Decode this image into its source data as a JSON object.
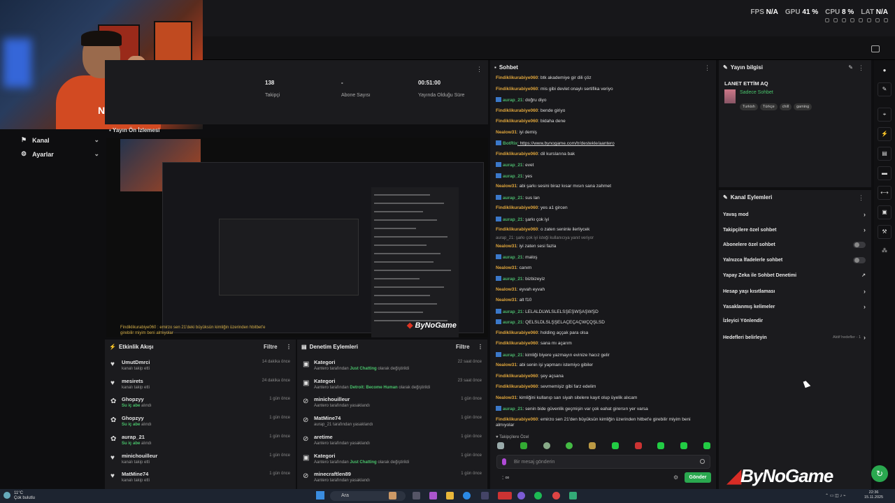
{
  "hud": {
    "fps_label": "FPS",
    "fps_value": "N/A",
    "gpu_label": "GPU",
    "gpu_value": "41 %",
    "cpu_label": "CPU",
    "cpu_value": "8 %",
    "lat_label": "LAT",
    "lat_value": "N/A"
  },
  "webcam": {
    "shirt_text": "NBA"
  },
  "sidebar": {
    "items": [
      {
        "label": "Kanal",
        "icon": "channel-icon"
      },
      {
        "label": "Ayarlar",
        "icon": "gear-icon"
      }
    ]
  },
  "stats": [
    {
      "value": "138",
      "label": "Takipçi"
    },
    {
      "value": "-",
      "label": "Abone Sayısı"
    },
    {
      "value": "00:51:00",
      "label": "Yayında Olduğu Süre"
    }
  ],
  "preview": {
    "title": "Yayın Ön İzlemesi",
    "caption": "Findiklikurabiye060 : emirzo sen 21'deki büyüksün kimliğin üzerinden hbitbet'e girebilir miyim beni almıyolar",
    "logo": "ByNoGame"
  },
  "activity": {
    "title": "Etkinlik Akışı",
    "filter": "Filtre",
    "items": [
      {
        "name": "UmutDmrci",
        "desc": "kanalı takip etti",
        "time": "14 dakika önce",
        "icon": "heart-icon"
      },
      {
        "name": "mesirets",
        "desc": "kanalı takip etti",
        "time": "24 dakika önce",
        "icon": "heart-icon"
      },
      {
        "name": "Ghopzyy",
        "desc_pre": "",
        "desc_hl": "Su iç abe",
        "desc_post": " alındı",
        "time": "1 gün önce",
        "icon": "reward-icon"
      },
      {
        "name": "Ghopzyy",
        "desc_pre": "",
        "desc_hl": "Su iç abe",
        "desc_post": " alındı",
        "time": "1 gün önce",
        "icon": "reward-icon"
      },
      {
        "name": "aurap_21",
        "desc_pre": "",
        "desc_hl": "Su iç abe",
        "desc_post": " alındı",
        "time": "1 gün önce",
        "icon": "reward-icon"
      },
      {
        "name": "minichouilleur",
        "desc": "kanalı takip etti",
        "time": "1 gün önce",
        "icon": "heart-icon"
      },
      {
        "name": "MatMine74",
        "desc": "kanalı takip etti",
        "time": "1 gün önce",
        "icon": "heart-icon"
      }
    ]
  },
  "moderation": {
    "title": "Denetim Eylemleri",
    "filter": "Filtre",
    "items": [
      {
        "name": "Kategori",
        "desc_pre": "Aantero tarafından ",
        "desc_hl": "Just Chatting",
        "desc_post": " olarak değiştirildi",
        "time": "22 saat önce",
        "icon": "category-icon"
      },
      {
        "name": "Kategori",
        "desc_pre": "Aantero tarafından ",
        "desc_hl": "Detroit: Become Human",
        "desc_post": " olarak değiştirildi",
        "time": "23 saat önce",
        "icon": "category-icon"
      },
      {
        "name": "minichouilleur",
        "desc": "Aantero tarafından yasaklandı",
        "time": "1 gün önce",
        "icon": "ban-icon"
      },
      {
        "name": "MatMine74",
        "desc": "aurap_21 tarafından yasaklandı",
        "time": "1 gün önce",
        "icon": "ban-icon"
      },
      {
        "name": "aretime",
        "desc": "Aantero tarafından yasaklandı",
        "time": "1 gün önce",
        "icon": "ban-icon"
      },
      {
        "name": "Kategori",
        "desc_pre": "Aantero tarafından ",
        "desc_hl": "Just Chatting",
        "desc_post": " olarak değiştirildi",
        "time": "1 gün önce",
        "icon": "category-icon"
      },
      {
        "name": "minecraftlen89",
        "desc": "Aantero tarafından yasaklandı",
        "time": "1 gün önce",
        "icon": "ban-icon"
      }
    ]
  },
  "chat": {
    "title": "Sohbet",
    "placeholder": "Bir mesaj gönderin",
    "send": "Gönder",
    "followers_only": "Takipçilere Özel",
    "reply_note": "aurap_21: şarkı çok iyi isteği kullanıcıya yanıt veriyor",
    "input_prefix": ":",
    "messages": [
      {
        "user": "Findiklikurabiye060",
        "text": ": btk akademiye gir dili çöz",
        "color": "#e0a63c",
        "badge": false
      },
      {
        "user": "Findiklikurabiye060",
        "text": ": mis gibi devlet onaylı sertifika veriyo",
        "color": "#e0a63c",
        "badge": false
      },
      {
        "user": "aurap_21",
        "text": ": doğru diyo",
        "color": "#4ab56b",
        "badge": true
      },
      {
        "user": "Findiklikurabiye060",
        "text": ": bende giriyo",
        "color": "#e0a63c",
        "badge": false
      },
      {
        "user": "Findiklikurabiye060",
        "text": ": bidaha dene",
        "color": "#e0a63c",
        "badge": false
      },
      {
        "user": "Nealow31",
        "text": ": iyi demiş",
        "color": "#e0a63c",
        "badge": false
      },
      {
        "user": "BotRix",
        "text": ": https://www.bynogame.com/tr/destekle/aantero",
        "color": "#4ab56b",
        "badge": true,
        "link": true
      },
      {
        "user": "Findiklikurabiye060",
        "text": ": dil kurslarına bak",
        "color": "#e0a63c",
        "badge": false
      },
      {
        "user": "aurap_21",
        "text": ": evet",
        "color": "#4ab56b",
        "badge": true
      },
      {
        "user": "aurap_21",
        "text": ": yes",
        "color": "#4ab56b",
        "badge": true
      },
      {
        "user": "Nealow31",
        "text": ": abi şarkı sesini biraz kısar mısın sana zahmet",
        "color": "#e0a63c",
        "badge": false
      },
      {
        "user": "aurap_21",
        "text": ": sus lan",
        "color": "#4ab56b",
        "badge": true
      },
      {
        "user": "Findiklikurabiye060",
        "text": ": yes a1 gircen",
        "color": "#e0a63c",
        "badge": false
      },
      {
        "user": "aurap_21",
        "text": ": şarkı çok iyi",
        "color": "#4ab56b",
        "badge": true
      },
      {
        "user": "Findiklikurabiye060",
        "text": ": o zaten seninle ilerliycek",
        "color": "#e0a63c",
        "badge": false
      },
      {
        "user": "Nealow31",
        "text": ": iyi zaten sesi fazla",
        "color": "#e0a63c",
        "badge": false
      },
      {
        "user": "aurap_21",
        "text": ": maloş",
        "color": "#4ab56b",
        "badge": true
      },
      {
        "user": "Nealow31",
        "text": ": canım",
        "color": "#e0a63c",
        "badge": false
      },
      {
        "user": "aurap_21",
        "text": ": bizbizeyiz",
        "color": "#4ab56b",
        "badge": true
      },
      {
        "user": "Nealow31",
        "text": ": eyvah eyvah",
        "color": "#e0a63c",
        "badge": false
      },
      {
        "user": "Nealow31",
        "text": ": alt f10",
        "color": "#e0a63c",
        "badge": false
      },
      {
        "user": "aurap_21",
        "text": ": LELALDLWLSLELSŞEŞWŞAŞWŞD",
        "color": "#4ab56b",
        "badge": true
      },
      {
        "user": "aurap_21",
        "text": ": QELSLDLSLŞŞELAÇEÇAÇWÇQŞLSD",
        "color": "#4ab56b",
        "badge": true
      },
      {
        "user": "Findiklikurabiye060",
        "text": ": holding aççak para olsa",
        "color": "#e0a63c",
        "badge": false
      },
      {
        "user": "Findiklikurabiye060",
        "text": ": sana mı açarım",
        "color": "#e0a63c",
        "badge": false
      },
      {
        "user": "aurap_21",
        "text": ": kimliği biyere yazmayın evinize hacız gelir",
        "color": "#4ab56b",
        "badge": true
      },
      {
        "user": "Nealow31",
        "text": ": abi senin işi yapmanı istemiyo gibiler",
        "color": "#e0a63c",
        "badge": false
      },
      {
        "user": "Findiklikurabiye060",
        "text": ": şey açsana",
        "color": "#e0a63c",
        "badge": false
      },
      {
        "user": "Findiklikurabiye060",
        "text": ": sevmemişiz gibi farz edelim",
        "color": "#e0a63c",
        "badge": false
      },
      {
        "user": "Nealow31",
        "text": ": kimliğini kullanıp sarı siyah sitelere kayıt olup üyelik alıcam",
        "color": "#e0a63c",
        "badge": false
      },
      {
        "user": "aurap_21",
        "text": ": senin bide güvenlik geçmişin var çok eahat girersın yer varsa",
        "color": "#4ab56b",
        "badge": true
      },
      {
        "user": "Findiklikurabiye060",
        "text": ": emirzo sen 21'den büyüksün kimliğin üzerinden hitbet'e girebilir miyim beni almıyolar",
        "color": "#e0a63c",
        "badge": false
      }
    ]
  },
  "stream_info": {
    "title": "Yayın bilgisi",
    "stream_title": "LANET ETTİM AQ",
    "category": "Sadece Sohbet",
    "tags": [
      "Turkish",
      "Türkçe",
      "chill",
      "gaming"
    ]
  },
  "channel_actions": {
    "title": "Kanal Eylemleri",
    "items": [
      {
        "label": "Yavaş mod",
        "type": "chevron"
      },
      {
        "label": "Takipçilere özel sohbet",
        "type": "chevron"
      },
      {
        "label": "Abonelere özel sohbet",
        "type": "toggle"
      },
      {
        "label": "Yalnızca İfadelerle sohbet",
        "type": "toggle"
      },
      {
        "label": "Yapay Zeka ile Sohbet Denetimi",
        "type": "external"
      },
      {
        "label": "Hesap yaşı kısıtlaması",
        "type": "chevron"
      },
      {
        "label": "Yasaklanmış kelimeler",
        "type": "chevron"
      },
      {
        "label": "İzleyici Yönlendir",
        "type": "none"
      },
      {
        "label": "Hedefleri belirleyin",
        "type": "chevron",
        "extra": "Aktif hedefler - 1"
      }
    ]
  },
  "brand": {
    "logo": "ByNoGame"
  },
  "taskbar": {
    "search": "Ara",
    "weather_temp": "11°C",
    "weather_desc": "Çok bulutlu",
    "time": "22:36",
    "date": "15.11.2025"
  }
}
